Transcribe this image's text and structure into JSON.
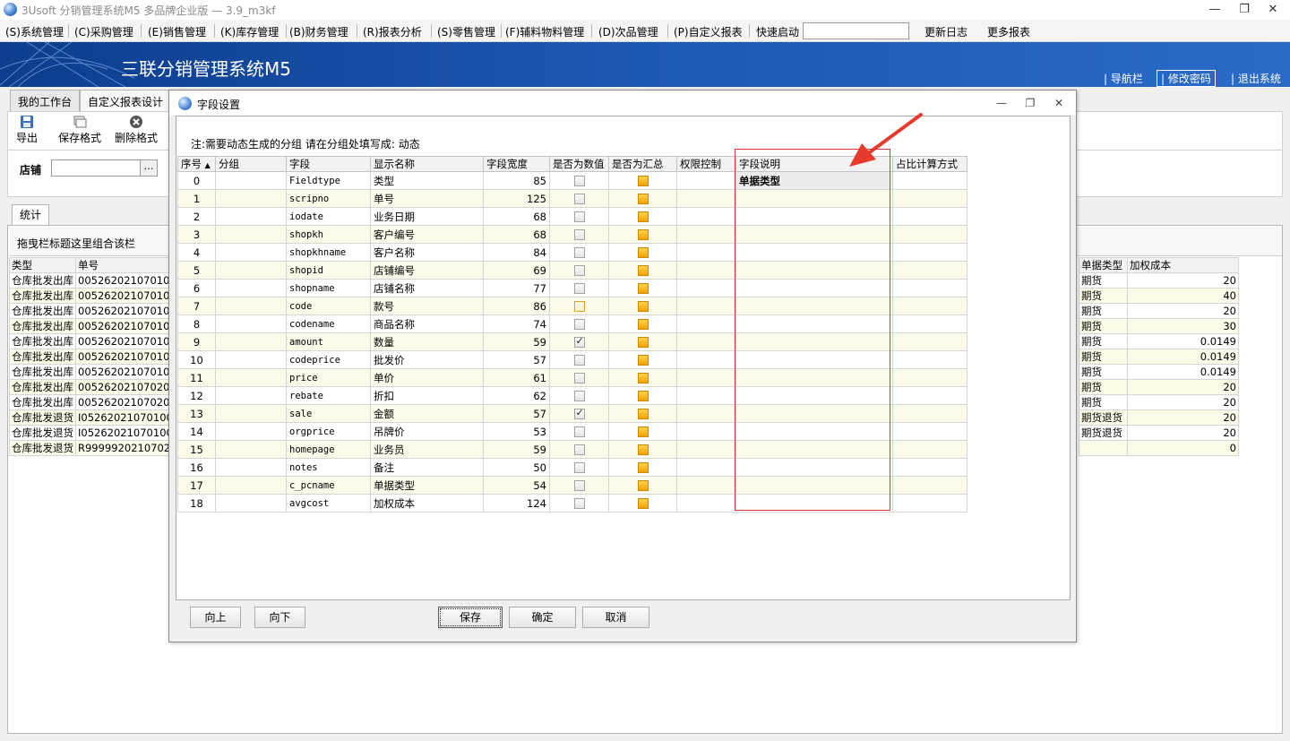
{
  "window": {
    "title": "3Usoft 分销管理系统M5 多品牌企业版 — 3.9_m3kf",
    "minimize": "—",
    "restore": "❐",
    "close": "✕"
  },
  "menu": {
    "items": [
      "(S)系统管理",
      "(C)采购管理",
      "(E)销售管理",
      "(K)库存管理",
      "(B)财务管理",
      "(R)报表分析",
      "(S)零售管理",
      "(F)辅料物料管理",
      "(D)次品管理",
      "(P)自定义报表"
    ],
    "quick_launch": "快速启动",
    "quick_value": "",
    "update_log": "更新日志",
    "more_reports": "更多报表"
  },
  "banner": {
    "title": "三联分销管理系统M5",
    "nav": "导航栏",
    "change_password": "修改密码",
    "logout": "退出系统"
  },
  "main": {
    "tabs": [
      "我的工作台",
      "自定义报表设计"
    ],
    "toolbar": {
      "export": "导出",
      "save_format": "保存格式",
      "delete_format": "删除格式"
    },
    "store_label": "店铺",
    "store_value": "",
    "store_btn": "…",
    "stat_tab": "统计",
    "group_hint": "拖曳栏标题这里组合该栏",
    "left_table": {
      "headers": [
        "类型",
        "单号"
      ],
      "rows": [
        [
          "仓库批发出库",
          "0052620210701001"
        ],
        [
          "仓库批发出库",
          "0052620210701001"
        ],
        [
          "仓库批发出库",
          "0052620210701001"
        ],
        [
          "仓库批发出库",
          "0052620210701001"
        ],
        [
          "仓库批发出库",
          "0052620210701001"
        ],
        [
          "仓库批发出库",
          "0052620210701001"
        ],
        [
          "仓库批发出库",
          "0052620210701001"
        ],
        [
          "仓库批发出库",
          "0052620210702001"
        ],
        [
          "仓库批发出库",
          "0052620210702001"
        ],
        [
          "仓库批发退货",
          "I052620210701001"
        ],
        [
          "仓库批发退货",
          "I052620210701001"
        ],
        [
          "仓库批发退货",
          "R9999920210702001"
        ]
      ]
    },
    "right_table": {
      "headers": [
        "单据类型",
        "加权成本"
      ],
      "rows": [
        [
          "期货",
          "20"
        ],
        [
          "期货",
          "40"
        ],
        [
          "期货",
          "20"
        ],
        [
          "期货",
          "30"
        ],
        [
          "期货",
          "0.0149"
        ],
        [
          "期货",
          "0.0149"
        ],
        [
          "期货",
          "0.0149"
        ],
        [
          "期货",
          "20"
        ],
        [
          "期货",
          "20"
        ],
        [
          "期货退货",
          "20"
        ],
        [
          "期货退货",
          "20"
        ],
        [
          "",
          "0"
        ]
      ]
    }
  },
  "dialog": {
    "title": "字段设置",
    "note": "注:需要动态生成的分组 请在分组处填写成: 动态",
    "headers": [
      "序号",
      "分组",
      "字段",
      "显示名称",
      "字段宽度",
      "是否为数值",
      "是否为汇总",
      "权限控制",
      "字段说明",
      "占比计算方式"
    ],
    "sort_indicator": "▲",
    "rows": [
      {
        "seq": "0",
        "group": "",
        "field": "Fieldtype",
        "display": "类型",
        "width": "85",
        "numeric": false,
        "summary": true,
        "perm": "",
        "desc": "单据类型",
        "ratio": ""
      },
      {
        "seq": "1",
        "group": "",
        "field": "scripno",
        "display": "单号",
        "width": "125",
        "numeric": false,
        "summary": true,
        "perm": "",
        "desc": "",
        "ratio": ""
      },
      {
        "seq": "2",
        "group": "",
        "field": "iodate",
        "display": "业务日期",
        "width": "68",
        "numeric": false,
        "summary": true,
        "perm": "",
        "desc": "",
        "ratio": ""
      },
      {
        "seq": "3",
        "group": "",
        "field": "shopkh",
        "display": "客户编号",
        "width": "68",
        "numeric": false,
        "summary": true,
        "perm": "",
        "desc": "",
        "ratio": ""
      },
      {
        "seq": "4",
        "group": "",
        "field": "shopkhname",
        "display": "客户名称",
        "width": "84",
        "numeric": false,
        "summary": true,
        "perm": "",
        "desc": "",
        "ratio": ""
      },
      {
        "seq": "5",
        "group": "",
        "field": "shopid",
        "display": "店铺编号",
        "width": "69",
        "numeric": false,
        "summary": true,
        "perm": "",
        "desc": "",
        "ratio": ""
      },
      {
        "seq": "6",
        "group": "",
        "field": "shopname",
        "display": "店铺名称",
        "width": "77",
        "numeric": false,
        "summary": true,
        "perm": "",
        "desc": "",
        "ratio": ""
      },
      {
        "seq": "7",
        "group": "",
        "field": "code",
        "display": "款号",
        "width": "86",
        "numeric": false,
        "summary": true,
        "perm": "",
        "desc": "",
        "ratio": ""
      },
      {
        "seq": "8",
        "group": "",
        "field": "codename",
        "display": "商品名称",
        "width": "74",
        "numeric": false,
        "summary": true,
        "perm": "",
        "desc": "",
        "ratio": ""
      },
      {
        "seq": "9",
        "group": "",
        "field": "amount",
        "display": "数量",
        "width": "59",
        "numeric": true,
        "summary": true,
        "perm": "",
        "desc": "",
        "ratio": ""
      },
      {
        "seq": "10",
        "group": "",
        "field": "codeprice",
        "display": "批发价",
        "width": "57",
        "numeric": false,
        "summary": true,
        "perm": "",
        "desc": "",
        "ratio": ""
      },
      {
        "seq": "11",
        "group": "",
        "field": "price",
        "display": "单价",
        "width": "61",
        "numeric": false,
        "summary": true,
        "perm": "",
        "desc": "",
        "ratio": ""
      },
      {
        "seq": "12",
        "group": "",
        "field": "rebate",
        "display": "折扣",
        "width": "62",
        "numeric": false,
        "summary": true,
        "perm": "",
        "desc": "",
        "ratio": ""
      },
      {
        "seq": "13",
        "group": "",
        "field": "sale",
        "display": "金额",
        "width": "57",
        "numeric": true,
        "summary": true,
        "perm": "",
        "desc": "",
        "ratio": ""
      },
      {
        "seq": "14",
        "group": "",
        "field": "orgprice",
        "display": "吊牌价",
        "width": "53",
        "numeric": false,
        "summary": true,
        "perm": "",
        "desc": "",
        "ratio": ""
      },
      {
        "seq": "15",
        "group": "",
        "field": "homepage",
        "display": "业务员",
        "width": "59",
        "numeric": false,
        "summary": true,
        "perm": "",
        "desc": "",
        "ratio": ""
      },
      {
        "seq": "16",
        "group": "",
        "field": "notes",
        "display": "备注",
        "width": "50",
        "numeric": false,
        "summary": true,
        "perm": "",
        "desc": "",
        "ratio": ""
      },
      {
        "seq": "17",
        "group": "",
        "field": "c_pcname",
        "display": "单据类型",
        "width": "54",
        "numeric": false,
        "summary": true,
        "perm": "",
        "desc": "",
        "ratio": ""
      },
      {
        "seq": "18",
        "group": "",
        "field": "avgcost",
        "display": "加权成本",
        "width": "124",
        "numeric": false,
        "summary": true,
        "perm": "",
        "desc": "",
        "ratio": ""
      }
    ],
    "buttons": {
      "up": "向上",
      "down": "向下",
      "save": "保存",
      "ok": "确定",
      "cancel": "取消"
    }
  },
  "colors": {
    "banner": "#1b56b3",
    "highlight_box": "#e23434",
    "arrow": "#e8392d",
    "summary_checkbox": "#f3a400"
  }
}
